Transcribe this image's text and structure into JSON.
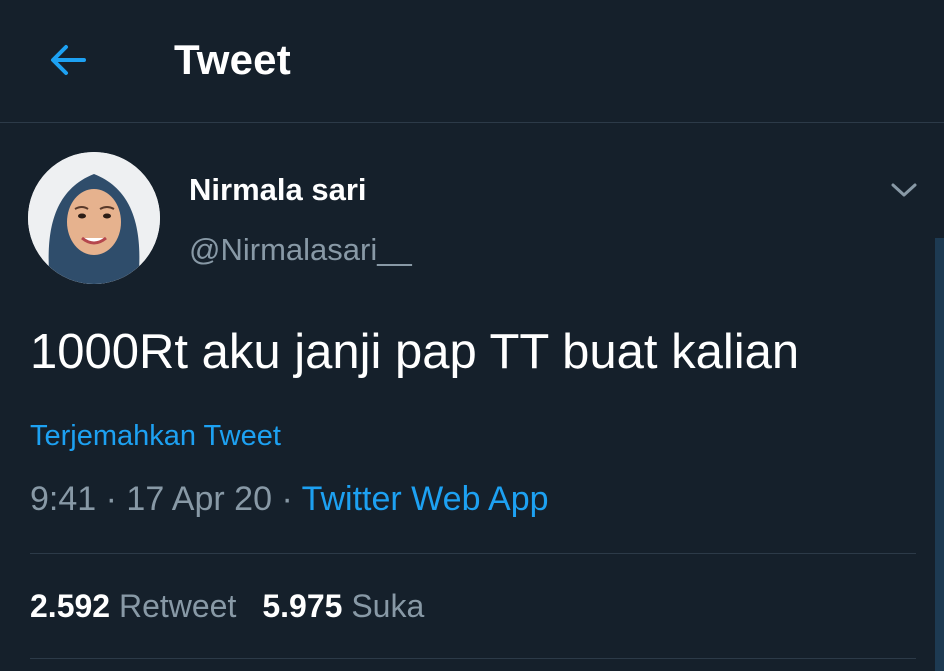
{
  "header": {
    "title": "Tweet",
    "back_icon": "arrow-left-icon"
  },
  "author": {
    "display_name": "Nirmala sari",
    "handle": "@Nirmalasari__",
    "avatar_icon": "profile-photo"
  },
  "tweet": {
    "text": "1000Rt aku janji pap TT buat kalian",
    "translate_label": "Terjemahkan Tweet",
    "time": "9:41",
    "date": "17 Apr 20",
    "separator": "·",
    "source": "Twitter Web App"
  },
  "stats": {
    "retweets_count": "2.592",
    "retweets_label": "Retweet",
    "likes_count": "5.975",
    "likes_label": "Suka"
  },
  "colors": {
    "background": "#15202b",
    "accent": "#1da1f2",
    "secondary_text": "#8899a6",
    "divider": "#2c3a48"
  }
}
